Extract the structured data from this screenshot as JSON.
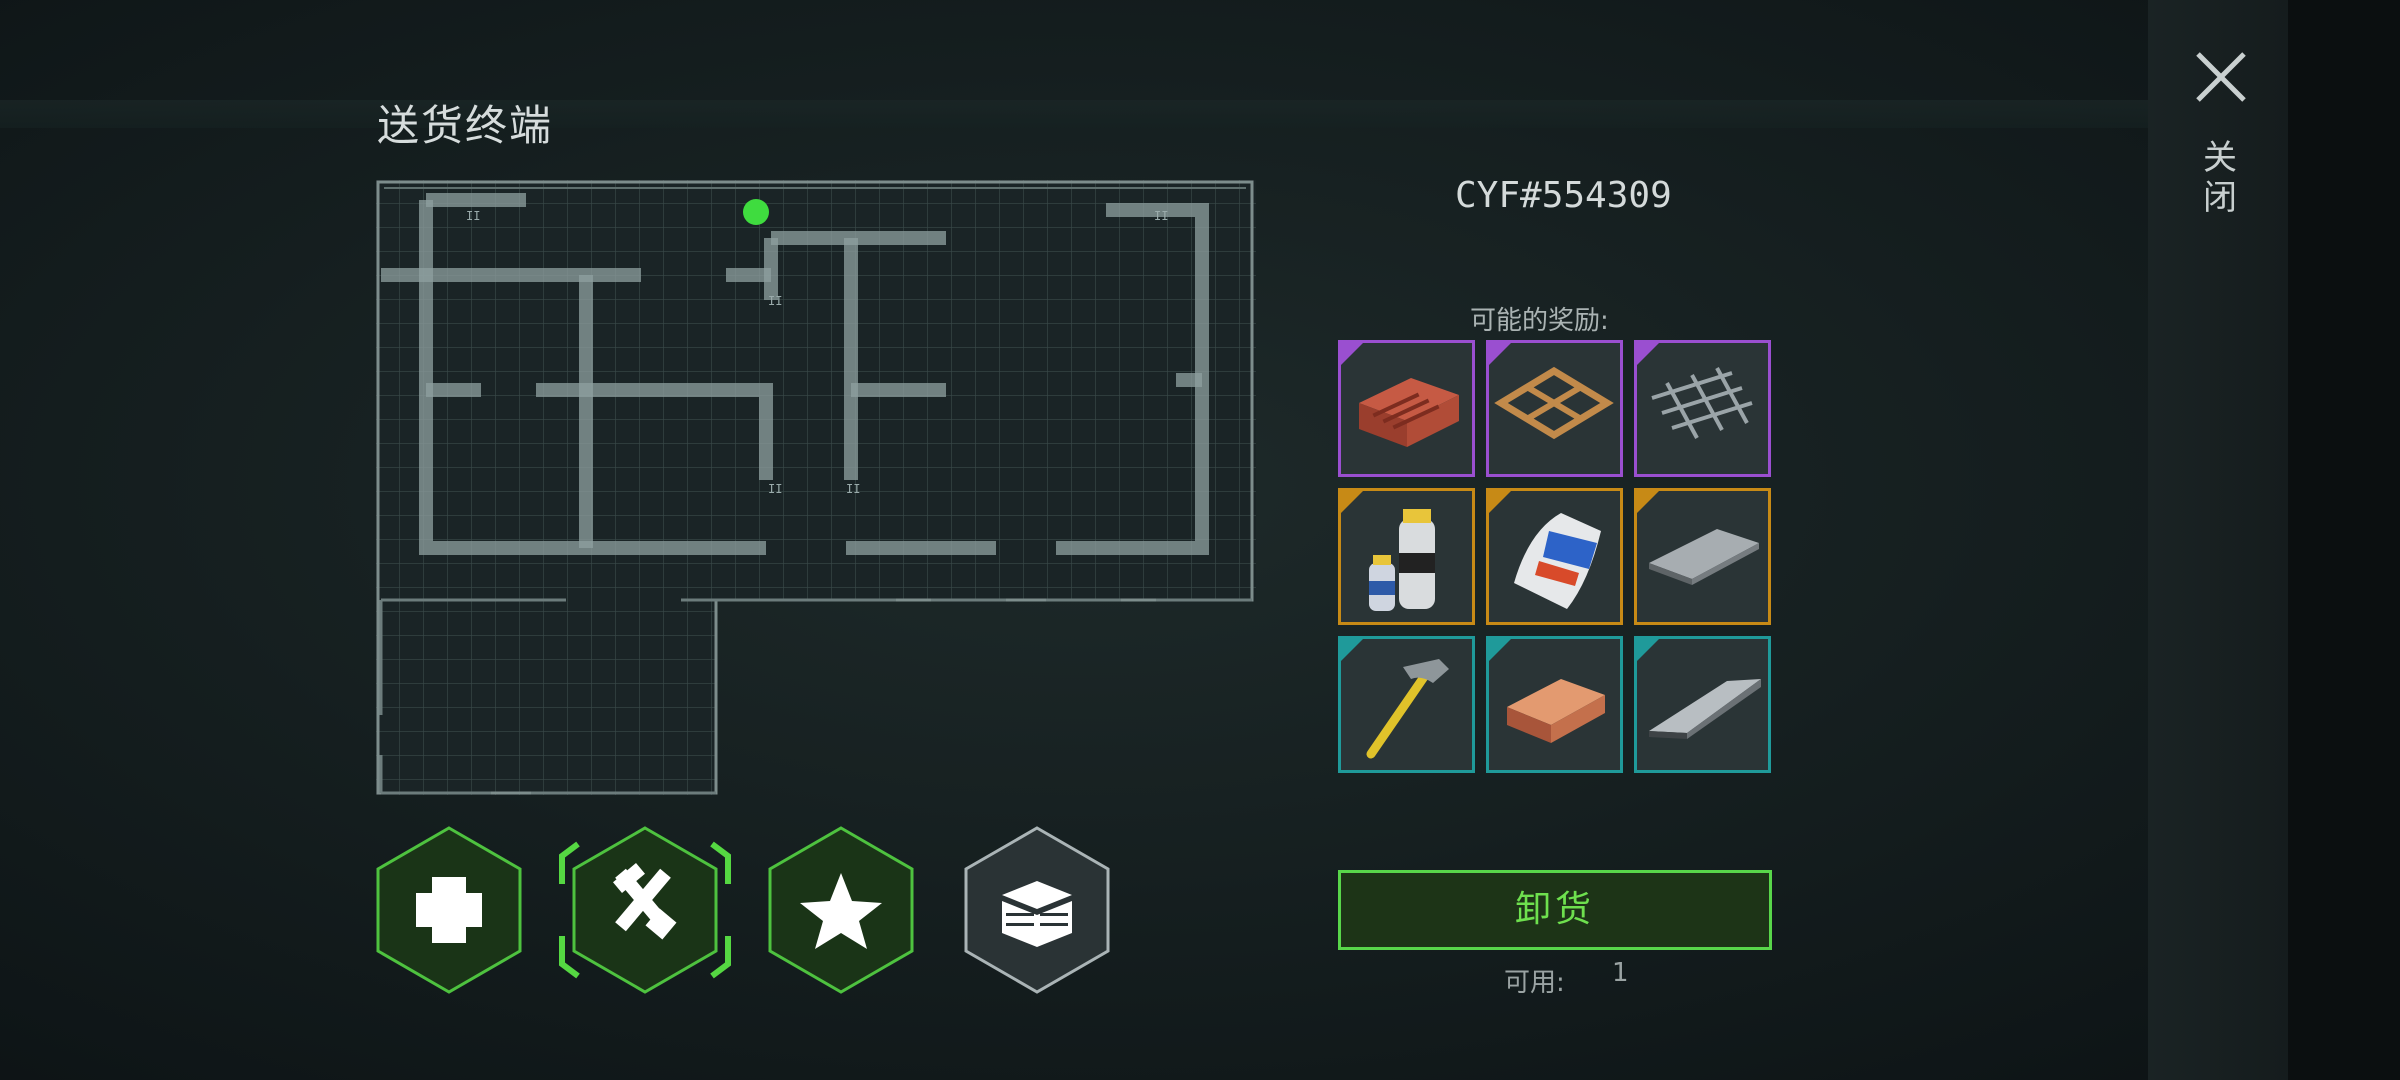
{
  "header": {
    "title": "送货终端",
    "close_label": "关闭"
  },
  "map": {
    "player_marker_color": "#3fdc3f"
  },
  "delivery": {
    "code": "CYF#554309"
  },
  "rewards": {
    "label": "可能的奖励:",
    "rarity_colors": {
      "epic": "#9a4fd0",
      "rare": "#c78a16",
      "uncommon": "#1f9a9a"
    },
    "items": [
      {
        "icon": "brick-icon",
        "rarity": "epic"
      },
      {
        "icon": "wooden-frame-icon",
        "rarity": "epic"
      },
      {
        "icon": "rebar-grid-icon",
        "rarity": "epic"
      },
      {
        "icon": "resin-hardener-icon",
        "rarity": "rare"
      },
      {
        "icon": "cement-bag-icon",
        "rarity": "rare"
      },
      {
        "icon": "metal-plate-icon",
        "rarity": "rare"
      },
      {
        "icon": "hammer-icon",
        "rarity": "uncommon"
      },
      {
        "icon": "copper-ingot-icon",
        "rarity": "uncommon"
      },
      {
        "icon": "steel-ingot-icon",
        "rarity": "uncommon"
      }
    ]
  },
  "categories": [
    {
      "icon": "medical-cross-icon",
      "selected": false
    },
    {
      "icon": "tools-icon",
      "selected": true
    },
    {
      "icon": "star-icon",
      "selected": false
    },
    {
      "icon": "crate-icon",
      "selected": false
    }
  ],
  "actions": {
    "unload_label": "卸货",
    "available_label": "可用:",
    "available_value": "1"
  },
  "colors": {
    "accent_green": "#58d64a"
  }
}
